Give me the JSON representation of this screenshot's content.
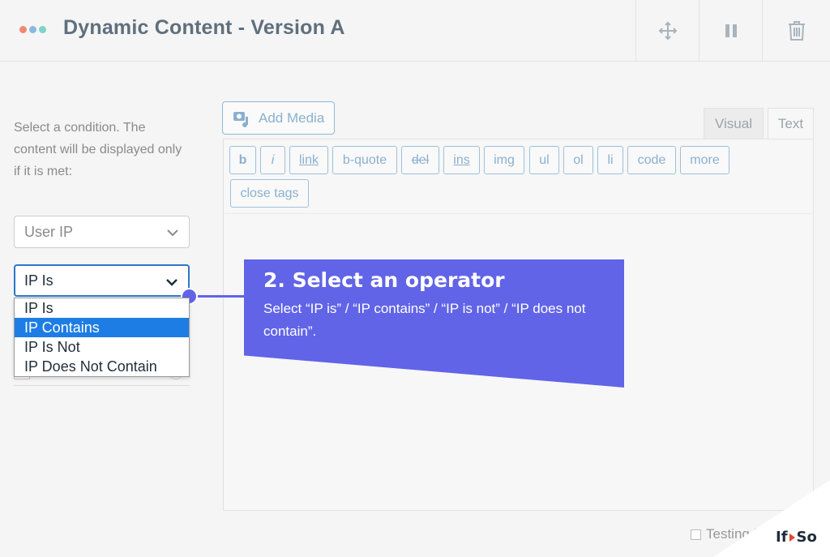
{
  "header": {
    "title": "Dynamic Content - Version A",
    "dot_colors": [
      "#f08a6f",
      "#8bb8e0",
      "#7fd3c9"
    ]
  },
  "sidebar": {
    "description": "Select a condition. The content will be displayed only if it is met:",
    "condition_select": {
      "value": "User IP"
    },
    "operator_select": {
      "value": "IP Is",
      "options": [
        "IP Is",
        "IP Contains",
        "IP Is Not",
        "IP Does Not Contain"
      ],
      "highlighted": "IP Contains"
    }
  },
  "editor": {
    "add_media_label": "Add Media",
    "tabs": {
      "visual": "Visual",
      "text": "Text",
      "active": "Text"
    },
    "quicktags": [
      "b",
      "i",
      "link",
      "b-quote",
      "del",
      "ins",
      "img",
      "ul",
      "ol",
      "li",
      "code",
      "more",
      "close tags"
    ]
  },
  "callout": {
    "title": "2. Select an operator",
    "body": "Select “IP is” / “IP contains” / “IP is not” / “IP does not contain”.",
    "color": "#6164e7"
  },
  "footer": {
    "testing_label": "Testing M",
    "logo_left": "If",
    "logo_right": "So"
  }
}
